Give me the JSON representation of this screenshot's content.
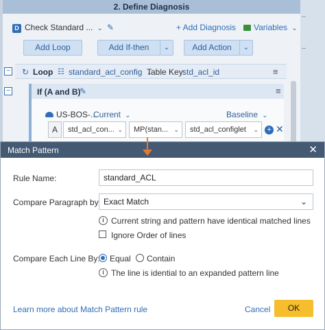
{
  "background": {
    "section_title": "2. Define Diagnosis",
    "toolbar": {
      "d_icon": "D",
      "diagnosis_name": "Check Standard ...",
      "add_diagnosis": "+ Add Diagnosis",
      "variables": "Variables"
    },
    "buttons": {
      "add_loop": "Add Loop",
      "add_if_then": "Add If-then",
      "add_action": "Add Action"
    },
    "loop": {
      "label": "Loop",
      "source": "standard_acl_config",
      "table_key_label": "Table Key:",
      "table_key_value": "std_acl_id"
    },
    "if_block": {
      "label": "If (A and B)",
      "device": "US-BOS-...",
      "current": "Current",
      "baseline": "Baseline",
      "operand_label": "A",
      "field1": "std_acl_con...",
      "field2": "MP(stan...",
      "field3": "std_acl_configlet"
    }
  },
  "modal": {
    "title": "Match Pattern",
    "rule_name_label": "Rule Name:",
    "rule_name_value": "standard_ACL",
    "compare_paragraph_label": "Compare Paragraph by:",
    "compare_paragraph_value": "Exact Match",
    "compare_paragraph_info": "Current string and pattern have identical matched lines",
    "ignore_order_label": "Ignore Order of lines",
    "ignore_order_checked": false,
    "compare_line_label": "Compare Each Line By:",
    "compare_line_options": [
      "Equal",
      "Contain"
    ],
    "compare_line_selected": "Equal",
    "compare_line_info": "The line is idential to an expanded pattern line",
    "learn_more": "Learn more about Match Pattern rule",
    "cancel": "Cancel",
    "ok": "OK"
  },
  "icons": {
    "close": "close-icon",
    "info": "info-icon",
    "pencil": "pencil-icon",
    "chevron": "chevron-down-icon",
    "loop": "loop-icon",
    "menu": "hamburger-icon",
    "arrow": "down-arrow-icon"
  },
  "colors": {
    "modal_header": "#445a73",
    "accent": "#2f6db5",
    "ok_button": "#f6be2c",
    "annotation_arrow": "#e8782b"
  }
}
